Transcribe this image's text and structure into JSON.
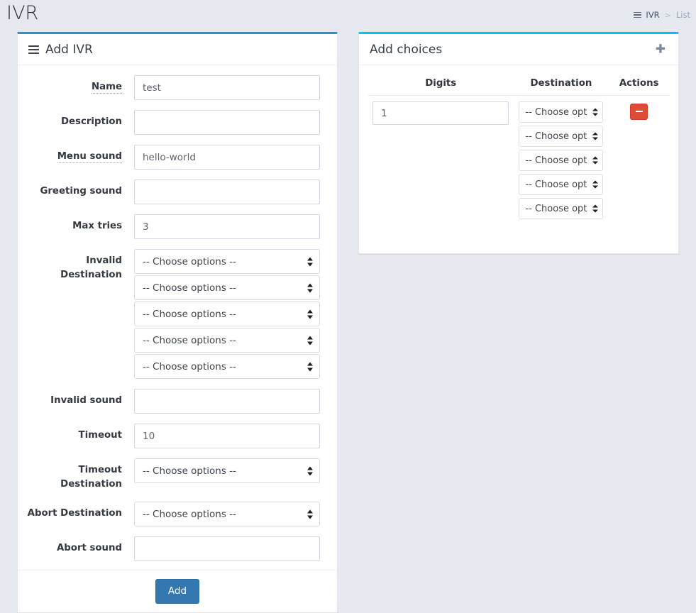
{
  "header": {
    "title": "IVR",
    "breadcrumb": {
      "menu_icon": "hamburger-icon",
      "root": "IVR",
      "separator": ">",
      "current": "List"
    }
  },
  "colors": {
    "page_background": "#e5e8ee",
    "primary_box_accent": "#3c8dbc",
    "info_box_accent": "#00c0ef",
    "add_button": "#3378b0",
    "remove_button": "#dd4b39"
  },
  "ivr_form": {
    "box_accent": "#3c8dbc",
    "title": "Add IVR",
    "title_icon": "hamburger-icon",
    "placeholder": "",
    "choose_option_label": "-- Choose options --",
    "fields": [
      {
        "label": "Name",
        "type": "text",
        "value": "test",
        "tooltip": true
      },
      {
        "label": "Description",
        "type": "text",
        "value": "",
        "tooltip": false
      },
      {
        "label": "Menu sound",
        "type": "text",
        "value": "hello-world",
        "tooltip": true
      },
      {
        "label": "Greeting sound",
        "type": "text",
        "value": "",
        "tooltip": false
      },
      {
        "label": "Max tries",
        "type": "text",
        "value": "3",
        "tooltip": false
      },
      {
        "label": "Invalid Destination",
        "type": "select-stack",
        "value": "",
        "count": 5,
        "tooltip": false
      },
      {
        "label": "Invalid sound",
        "type": "text",
        "value": "",
        "tooltip": false
      },
      {
        "label": "Timeout",
        "type": "text",
        "value": "10",
        "tooltip": false
      },
      {
        "label": "Timeout Destination",
        "type": "select",
        "value": "",
        "tooltip": false
      },
      {
        "label": "Abort Destination",
        "type": "select",
        "value": "",
        "tooltip": false
      },
      {
        "label": "Abort sound",
        "type": "text",
        "value": "",
        "tooltip": false
      }
    ],
    "submit_label": "Add"
  },
  "choices_panel": {
    "box_accent": "#00c0ef",
    "title": "Add choices",
    "add_icon": "plus-icon",
    "columns": [
      "Digits",
      "Destination",
      "Actions"
    ],
    "choose_option_label": "-- Choose opt",
    "rows": [
      {
        "digits": "1",
        "destination_count": 5,
        "remove_icon": "minus-icon"
      }
    ]
  }
}
